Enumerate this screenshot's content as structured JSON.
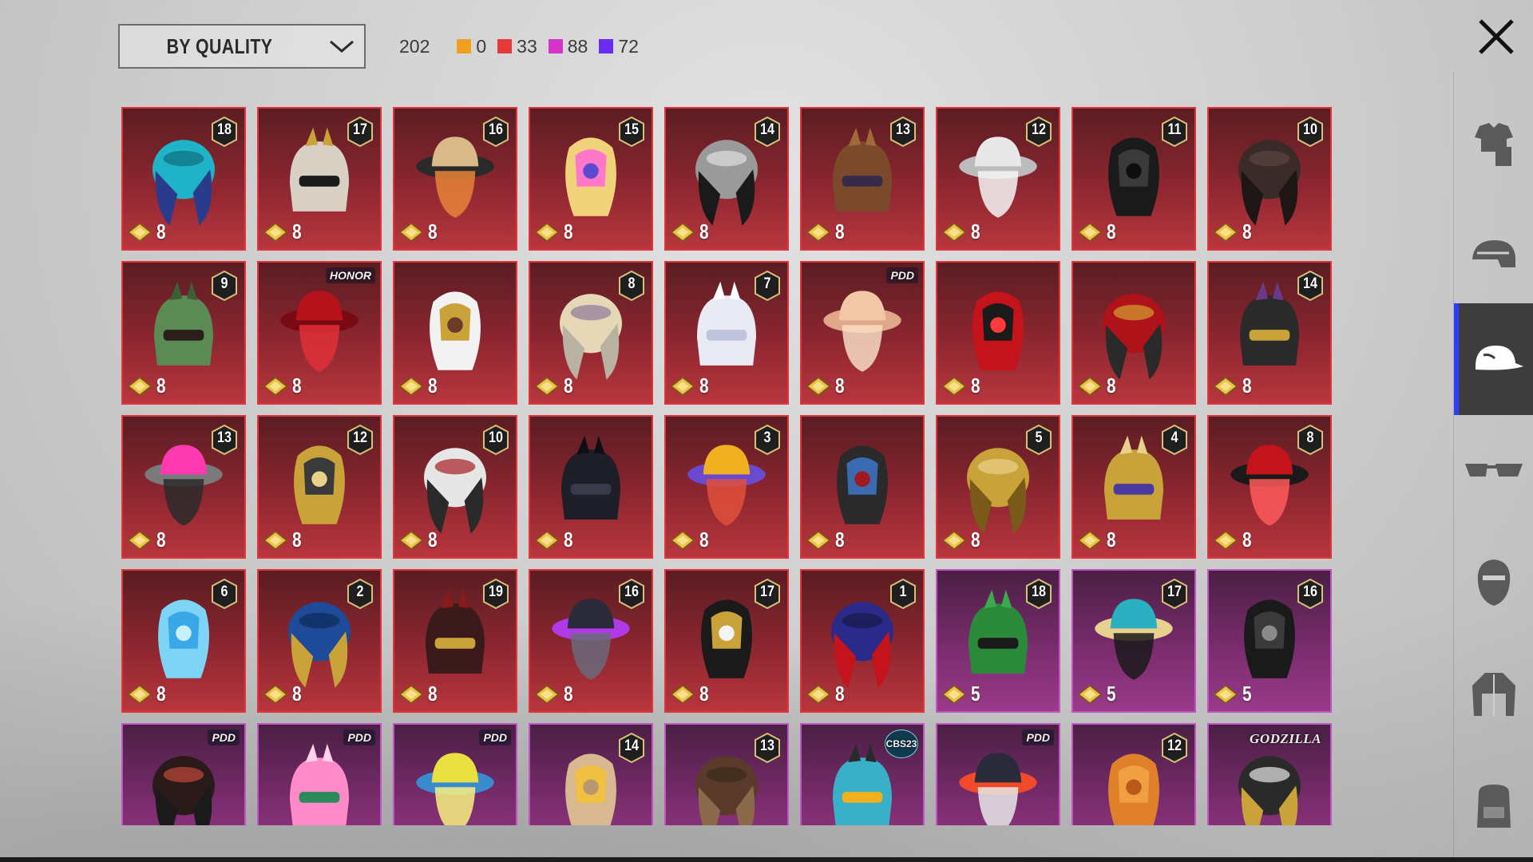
{
  "header": {
    "sort_label": "BY QUALITY",
    "total": "202",
    "counts": [
      {
        "color": "#f0a020",
        "value": "0"
      },
      {
        "color": "#e63a3a",
        "value": "33"
      },
      {
        "color": "#d533c9",
        "value": "88"
      },
      {
        "color": "#6a2cf0",
        "value": "72"
      }
    ]
  },
  "sidebar": {
    "tabs": [
      {
        "icon": "outfit-icon",
        "active": false
      },
      {
        "icon": "helmet-icon",
        "active": false
      },
      {
        "icon": "cap-icon",
        "active": true
      },
      {
        "icon": "glasses-icon",
        "active": false
      },
      {
        "icon": "mask-icon",
        "active": false
      },
      {
        "icon": "jacket-icon",
        "active": false
      },
      {
        "icon": "backpack-icon",
        "active": false
      }
    ]
  },
  "items": [
    {
      "quality": "red",
      "cost": "8",
      "level": "18",
      "tag": "",
      "art": "teal-feather-headdress"
    },
    {
      "quality": "red",
      "cost": "8",
      "level": "17",
      "tag": "",
      "art": "skull-horned-mask"
    },
    {
      "quality": "red",
      "cost": "8",
      "level": "16",
      "tag": "",
      "art": "cat-ear-goggles-hair"
    },
    {
      "quality": "red",
      "cost": "8",
      "level": "15",
      "tag": "",
      "art": "blonde-pink-hair"
    },
    {
      "quality": "red",
      "cost": "8",
      "level": "14",
      "tag": "",
      "art": "wolf-mask"
    },
    {
      "quality": "red",
      "cost": "8",
      "level": "13",
      "tag": "",
      "art": "purple-hat-curls"
    },
    {
      "quality": "red",
      "cost": "8",
      "level": "12",
      "tag": "",
      "art": "silver-bunny-hair"
    },
    {
      "quality": "red",
      "cost": "8",
      "level": "11",
      "tag": "",
      "art": "black-hair"
    },
    {
      "quality": "red",
      "cost": "8",
      "level": "10",
      "tag": "",
      "art": "dark-braids"
    },
    {
      "quality": "red",
      "cost": "8",
      "level": "9",
      "tag": "",
      "art": "green-face-hair"
    },
    {
      "quality": "red",
      "cost": "8",
      "level": "",
      "tag": "HONOR",
      "art": "red-long-hair"
    },
    {
      "quality": "red",
      "cost": "8",
      "level": "",
      "tag": "",
      "art": "white-cowboy-hat"
    },
    {
      "quality": "red",
      "cost": "8",
      "level": "8",
      "tag": "",
      "art": "blonde-wing-hair"
    },
    {
      "quality": "red",
      "cost": "8",
      "level": "7",
      "tag": "",
      "art": "white-long-hair"
    },
    {
      "quality": "red",
      "cost": "8",
      "level": "",
      "tag": "PDD",
      "art": "peach-long-hair"
    },
    {
      "quality": "red",
      "cost": "8",
      "level": "",
      "tag": "",
      "art": "red-helmet"
    },
    {
      "quality": "red",
      "cost": "8",
      "level": "",
      "tag": "",
      "art": "red-cyber-helmet"
    },
    {
      "quality": "red",
      "cost": "8",
      "level": "14",
      "tag": "",
      "art": "gold-horn-veil"
    },
    {
      "quality": "red",
      "cost": "8",
      "level": "13",
      "tag": "",
      "art": "pink-dreads-mask"
    },
    {
      "quality": "red",
      "cost": "8",
      "level": "12",
      "tag": "",
      "art": "gold-wing-helmet"
    },
    {
      "quality": "red",
      "cost": "8",
      "level": "10",
      "tag": "",
      "art": "chef-hat-mask"
    },
    {
      "quality": "red",
      "cost": "8",
      "level": "",
      "tag": "",
      "art": "dark-bat-helmet"
    },
    {
      "quality": "red",
      "cost": "8",
      "level": "3",
      "tag": "",
      "art": "fries-box"
    },
    {
      "quality": "red",
      "cost": "8",
      "level": "",
      "tag": "",
      "art": "cap-mask"
    },
    {
      "quality": "red",
      "cost": "8",
      "level": "5",
      "tag": "",
      "art": "gold-knight-helmet"
    },
    {
      "quality": "red",
      "cost": "8",
      "level": "4",
      "tag": "",
      "art": "gold-purple-helmet"
    },
    {
      "quality": "red",
      "cost": "8",
      "level": "8",
      "tag": "",
      "art": "red-rose-hat"
    },
    {
      "quality": "red",
      "cost": "8",
      "level": "6",
      "tag": "",
      "art": "ice-block"
    },
    {
      "quality": "red",
      "cost": "8",
      "level": "2",
      "tag": "",
      "art": "blue-samurai-helmet"
    },
    {
      "quality": "red",
      "cost": "8",
      "level": "19",
      "tag": "",
      "art": "samurai-demon-helmet"
    },
    {
      "quality": "red",
      "cost": "8",
      "level": "16",
      "tag": "",
      "art": "purple-visor-helmet"
    },
    {
      "quality": "red",
      "cost": "8",
      "level": "17",
      "tag": "",
      "art": "black-gold-mask"
    },
    {
      "quality": "red",
      "cost": "8",
      "level": "1",
      "tag": "",
      "art": "blue-red-helmet"
    },
    {
      "quality": "purple",
      "cost": "5",
      "level": "18",
      "tag": "",
      "art": "green-beanie"
    },
    {
      "quality": "purple",
      "cost": "5",
      "level": "17",
      "tag": "",
      "art": "teal-cap-blonde"
    },
    {
      "quality": "purple",
      "cost": "5",
      "level": "16",
      "tag": "",
      "art": "black-hair-headset"
    },
    {
      "quality": "purple",
      "cost": "",
      "level": "",
      "tag": "PDD",
      "art": "ponytail"
    },
    {
      "quality": "purple",
      "cost": "",
      "level": "",
      "tag": "PDD",
      "art": "pink-bow-headband"
    },
    {
      "quality": "purple",
      "cost": "",
      "level": "",
      "tag": "PDD",
      "art": "yellow-box-head"
    },
    {
      "quality": "purple",
      "cost": "",
      "level": "14",
      "tag": "",
      "art": "flower-hair"
    },
    {
      "quality": "purple",
      "cost": "",
      "level": "13",
      "tag": "",
      "art": "goggle-curls"
    },
    {
      "quality": "purple",
      "cost": "",
      "level": "",
      "tag": "CBS23",
      "art": "cat-headphones"
    },
    {
      "quality": "purple",
      "cost": "",
      "level": "",
      "tag": "PDD",
      "art": "cap-sunglasses"
    },
    {
      "quality": "purple",
      "cost": "",
      "level": "12",
      "tag": "",
      "art": "orange-pigtails"
    },
    {
      "quality": "purple",
      "cost": "",
      "level": "",
      "tag": "GODZILLA",
      "art": "spiked-cap"
    }
  ]
}
